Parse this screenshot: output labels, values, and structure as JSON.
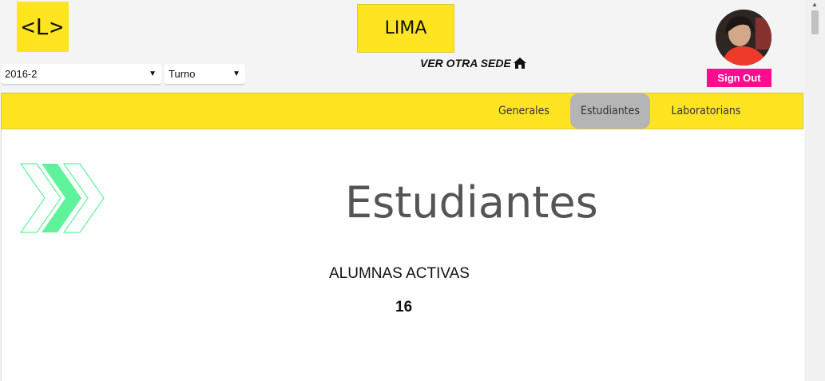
{
  "header": {
    "logo_text": "<L>",
    "sede_name": "LIMA",
    "ver_otra_sede": "VER OTRA SEDE",
    "sign_out": "Sign Out"
  },
  "filters": {
    "year": "2016-2",
    "turno": "Turno"
  },
  "nav": {
    "items": [
      {
        "label": "Generales"
      },
      {
        "label": "Estudiantes",
        "active": true
      },
      {
        "label": "Laboratorians"
      }
    ]
  },
  "main": {
    "title": "Estudiantes",
    "activas_label": "ALUMNAS ACTIVAS",
    "activas_count": "16"
  },
  "colors": {
    "brand_yellow": "#ffe521",
    "sign_out_pink": "#ff0c8f",
    "chevron_green": "#5ef39a",
    "active_tab_gray": "#b5b5b5"
  },
  "icons": [
    "home-icon",
    "chevron-arrows-icon",
    "dropdown-arrow-icon",
    "scroll-up-icon"
  ]
}
